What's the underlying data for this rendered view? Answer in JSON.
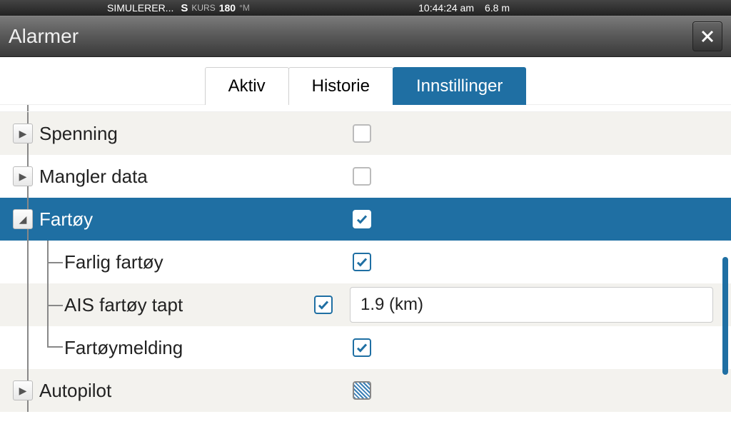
{
  "statusBar": {
    "simText": "SIMULERER...",
    "kursPrefix": "S",
    "kursLabel": "KURS",
    "kursValue": "180",
    "kursUnit": "°M",
    "time": "10:44:24 am",
    "depth": "6.8 m"
  },
  "title": "Alarmer",
  "tabs": {
    "aktiv": "Aktiv",
    "historie": "Historie",
    "innstillinger": "Innstillinger"
  },
  "rows": {
    "spenning": {
      "label": "Spenning",
      "checked": false,
      "expanded": false
    },
    "manglerData": {
      "label": "Mangler data",
      "checked": false,
      "expanded": false
    },
    "fartoy": {
      "label": "Fartøy",
      "checked": true,
      "expanded": true
    },
    "farligFartoy": {
      "label": "Farlig fartøy",
      "checked": true
    },
    "aisTapt": {
      "label": "AIS fartøy tapt",
      "checked": true,
      "value": "1.9 (km)"
    },
    "fartoymelding": {
      "label": "Fartøymelding",
      "checked": true
    },
    "autopilot": {
      "label": "Autopilot",
      "checked": "partial",
      "expanded": false
    }
  }
}
